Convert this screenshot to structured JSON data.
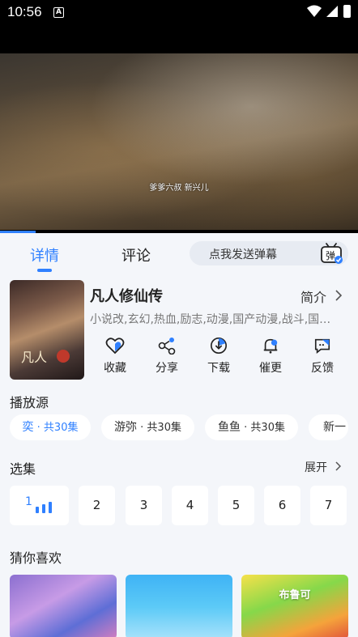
{
  "status_bar": {
    "time": "10:56",
    "notification_icon": "A"
  },
  "video": {
    "subtitle": "爹爹六叔 新兴儿",
    "progress_fraction": 0.1
  },
  "tabs": [
    {
      "label": "详情",
      "active": true
    },
    {
      "label": "评论",
      "active": false
    }
  ],
  "danmaku": {
    "placeholder": "点我发送弹幕",
    "icon_label": "弹"
  },
  "show": {
    "poster_title": "凡人",
    "title": "凡人修仙传",
    "intro_label": "简介",
    "tags": "小说改,玄幻,热血,励志,动漫,国产动漫,战斗,国漫,古风"
  },
  "actions": [
    {
      "label": "收藏",
      "icon": "heart-icon"
    },
    {
      "label": "分享",
      "icon": "share-icon"
    },
    {
      "label": "下载",
      "icon": "download-icon"
    },
    {
      "label": "催更",
      "icon": "bell-icon"
    },
    {
      "label": "反馈",
      "icon": "feedback-icon"
    }
  ],
  "sources": {
    "title": "播放源",
    "items": [
      {
        "name": "奕",
        "count": "· 共30集",
        "active": true
      },
      {
        "name": "游弥",
        "count": "· 共30集",
        "active": false
      },
      {
        "name": "鱼鱼",
        "count": "· 共30集",
        "active": false
      },
      {
        "name": "新一",
        "count": "",
        "active": false
      }
    ]
  },
  "episodes": {
    "title": "选集",
    "expand_label": "展开",
    "items": [
      "1",
      "2",
      "3",
      "4",
      "5",
      "6",
      "7"
    ],
    "current": "1"
  },
  "recommend": {
    "title": "猜你喜欢",
    "cards": [
      {
        "label": ""
      },
      {
        "label": ""
      },
      {
        "label": "布鲁可"
      }
    ]
  },
  "colors": {
    "accent": "#2f80ff",
    "background": "#f4f6fa"
  }
}
